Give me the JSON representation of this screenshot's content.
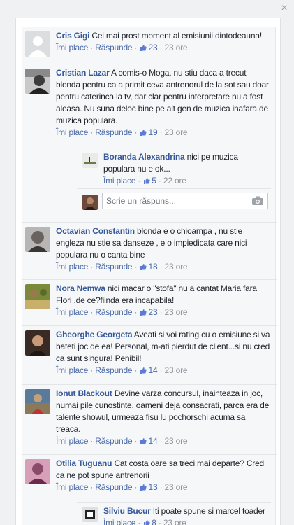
{
  "close_label": "×",
  "actions": {
    "like": "Îmi place",
    "reply": "Răspunde",
    "separator": "·"
  },
  "compose_placeholder": "Scrie un răspuns...",
  "comments": [
    {
      "name": "Cris Gigi",
      "text": "Cel mai prost moment al emisiunii dintodeauna!",
      "likes": "23",
      "time": "23 ore"
    },
    {
      "name": "Cristian Lazar",
      "text": "A comis-o Moga, nu stiu daca a trecut blonda pentru ca a primit ceva antrenorul de la sot sau doar pentru caterinca la tv, dar clar pentru interpretare nu a fost aleasa. Nu suna deloc bine pe alt gen de muzica inafara de muzica populara.",
      "likes": "19",
      "time": "23 ore",
      "reply": {
        "name": "Boranda Alexandrina",
        "text": "nici pe muzica populara nu e ok...",
        "likes": "5",
        "time": "22 ore"
      }
    },
    {
      "name": "Octavian Constantin",
      "text": "blonda e o chioampa , nu stie engleza nu stie sa danseze , e o impiedicata care nici populara nu o canta bine",
      "likes": "18",
      "time": "23 ore"
    },
    {
      "name": "Nora Nemwa",
      "text": "nici macar o \"stofa\" nu a cantat Maria fara Flori ,de ce?fiinda era incapabila!",
      "likes": "23",
      "time": "23 ore"
    },
    {
      "name": "Gheorghe Georgeta",
      "text": "Aveati si voi rating cu o emisiune si va bateti joc de ea! Personal, m-ati pierdut de client...si nu cred ca sunt singura! Penibil!",
      "likes": "14",
      "time": "23 ore"
    },
    {
      "name": "Ionut Blackout",
      "text": "Devine varza concursul, inainteaza in joc, numai pile cunostinte, oameni deja consacrati, parca era de talente showul, urmeaza fisu lu pochorschi acuma sa treaca.",
      "likes": "14",
      "time": "23 ore"
    },
    {
      "name": "Otilia Tuguanu",
      "text": "Cat costa oare sa treci mai departe? Cred ca ne pot spune antrenorii",
      "likes": "13",
      "time": "23 ore",
      "reply": {
        "name": "Silviu Bucur",
        "text": "Iti poate spune si marcel toader",
        "likes": "8",
        "time": "23 ore"
      }
    }
  ]
}
